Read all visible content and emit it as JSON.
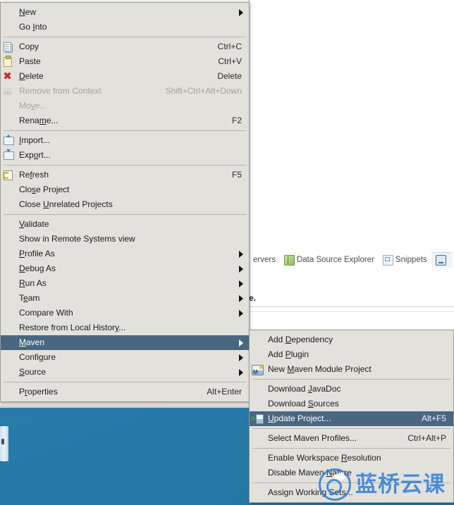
{
  "desktop": {
    "accent_color": "#2b7cab"
  },
  "ide": {
    "tabs": [
      {
        "label": "ervers",
        "icon": "",
        "active": false
      },
      {
        "label": "Data Source Explorer",
        "icon": "data-source-icon",
        "active": false
      },
      {
        "label": "Snippets",
        "icon": "snippets-icon",
        "active": false
      },
      {
        "label": "",
        "icon": "console-icon",
        "active": true
      }
    ],
    "editor_fragment": "e."
  },
  "context_menu": {
    "name": "project-context-menu",
    "groups": [
      {
        "items": [
          {
            "label": "New",
            "mnemonic": "N",
            "accel": "",
            "submenu": true,
            "icon": "",
            "disabled": false,
            "selected": false
          },
          {
            "label": "Go Into",
            "mnemonic": "I",
            "accel": "",
            "submenu": false,
            "icon": "",
            "disabled": false,
            "selected": false
          }
        ]
      },
      {
        "items": [
          {
            "label": "Copy",
            "mnemonic": "",
            "accel": "Ctrl+C",
            "submenu": false,
            "icon": "copy-icon",
            "disabled": false,
            "selected": false
          },
          {
            "label": "Paste",
            "mnemonic": "",
            "accel": "Ctrl+V",
            "submenu": false,
            "icon": "paste-icon",
            "disabled": false,
            "selected": false
          },
          {
            "label": "Delete",
            "mnemonic": "D",
            "accel": "Delete",
            "submenu": false,
            "icon": "delete-icon",
            "disabled": false,
            "selected": false
          },
          {
            "label": "Remove from Context",
            "mnemonic": "",
            "accel": "Shift+Ctrl+Alt+Down",
            "submenu": false,
            "icon": "remove-context-icon",
            "disabled": true,
            "selected": false
          },
          {
            "label": "Move...",
            "mnemonic": "v",
            "accel": "",
            "submenu": false,
            "icon": "",
            "disabled": true,
            "selected": false
          },
          {
            "label": "Rename...",
            "mnemonic": "m",
            "accel": "F2",
            "submenu": false,
            "icon": "",
            "disabled": false,
            "selected": false
          }
        ]
      },
      {
        "items": [
          {
            "label": "Import...",
            "mnemonic": "I",
            "accel": "",
            "submenu": false,
            "icon": "import-icon",
            "disabled": false,
            "selected": false
          },
          {
            "label": "Export...",
            "mnemonic": "o",
            "accel": "",
            "submenu": false,
            "icon": "export-icon",
            "disabled": false,
            "selected": false
          }
        ]
      },
      {
        "items": [
          {
            "label": "Refresh",
            "mnemonic": "f",
            "accel": "F5",
            "submenu": false,
            "icon": "refresh-icon",
            "disabled": false,
            "selected": false
          },
          {
            "label": "Close Project",
            "mnemonic": "s",
            "accel": "",
            "submenu": false,
            "icon": "",
            "disabled": false,
            "selected": false
          },
          {
            "label": "Close Unrelated Projects",
            "mnemonic": "U",
            "accel": "",
            "submenu": false,
            "icon": "",
            "disabled": false,
            "selected": false
          }
        ]
      },
      {
        "items": [
          {
            "label": "Validate",
            "mnemonic": "V",
            "accel": "",
            "submenu": false,
            "icon": "",
            "disabled": false,
            "selected": false
          },
          {
            "label": "Show in Remote Systems view",
            "mnemonic": "",
            "accel": "",
            "submenu": false,
            "icon": "",
            "disabled": false,
            "selected": false
          },
          {
            "label": "Profile As",
            "mnemonic": "P",
            "accel": "",
            "submenu": true,
            "icon": "",
            "disabled": false,
            "selected": false
          },
          {
            "label": "Debug As",
            "mnemonic": "D",
            "accel": "",
            "submenu": true,
            "icon": "",
            "disabled": false,
            "selected": false
          },
          {
            "label": "Run As",
            "mnemonic": "R",
            "accel": "",
            "submenu": true,
            "icon": "",
            "disabled": false,
            "selected": false
          },
          {
            "label": "Team",
            "mnemonic": "e",
            "accel": "",
            "submenu": true,
            "icon": "",
            "disabled": false,
            "selected": false
          },
          {
            "label": "Compare With",
            "mnemonic": "",
            "accel": "",
            "submenu": true,
            "icon": "",
            "disabled": false,
            "selected": false
          },
          {
            "label": "Restore from Local History...",
            "mnemonic": "y",
            "accel": "",
            "submenu": false,
            "icon": "",
            "disabled": false,
            "selected": false
          },
          {
            "label": "Maven",
            "mnemonic": "M",
            "accel": "",
            "submenu": true,
            "icon": "",
            "disabled": false,
            "selected": true
          },
          {
            "label": "Configure",
            "mnemonic": "g",
            "accel": "",
            "submenu": true,
            "icon": "",
            "disabled": false,
            "selected": false
          },
          {
            "label": "Source",
            "mnemonic": "S",
            "accel": "",
            "submenu": true,
            "icon": "",
            "disabled": false,
            "selected": false
          }
        ]
      },
      {
        "items": [
          {
            "label": "Properties",
            "mnemonic": "r",
            "accel": "Alt+Enter",
            "submenu": false,
            "icon": "",
            "disabled": false,
            "selected": false
          }
        ]
      }
    ]
  },
  "maven_submenu": {
    "name": "maven-submenu",
    "groups": [
      {
        "items": [
          {
            "label": "Add Dependency",
            "mnemonic": "D",
            "accel": "",
            "icon": "",
            "selected": false
          },
          {
            "label": "Add Plugin",
            "mnemonic": "P",
            "accel": "",
            "icon": "",
            "selected": false
          },
          {
            "label": "New Maven Module Project",
            "mnemonic": "M",
            "accel": "",
            "icon": "maven-module-icon",
            "selected": false
          }
        ]
      },
      {
        "items": [
          {
            "label": "Download JavaDoc",
            "mnemonic": "J",
            "accel": "",
            "icon": "",
            "selected": false
          },
          {
            "label": "Download Sources",
            "mnemonic": "S",
            "accel": "",
            "icon": "",
            "selected": false
          },
          {
            "label": "Update Project...",
            "mnemonic": "U",
            "accel": "Alt+F5",
            "icon": "update-project-icon",
            "selected": true
          }
        ]
      },
      {
        "items": [
          {
            "label": "Select Maven Profiles...",
            "mnemonic": "",
            "accel": "Ctrl+Alt+P",
            "icon": "",
            "selected": false
          }
        ]
      },
      {
        "items": [
          {
            "label": "Enable Workspace Resolution",
            "mnemonic": "R",
            "accel": "",
            "icon": "",
            "selected": false
          },
          {
            "label": "Disable Maven Nature",
            "mnemonic": "N",
            "accel": "",
            "icon": "",
            "selected": false
          }
        ]
      },
      {
        "items": [
          {
            "label": "Assign Working Sets...",
            "mnemonic": "",
            "accel": "",
            "icon": "",
            "selected": false
          }
        ]
      }
    ]
  },
  "watermark": {
    "text": "蓝桥云课",
    "color": "#2f7fd6"
  },
  "colors": {
    "menu_bg": "#e3e1dc",
    "menu_border": "#9e9b95",
    "highlight": "#4a6782",
    "highlight_text": "#ffffff",
    "disabled_text": "#a6a29b"
  }
}
